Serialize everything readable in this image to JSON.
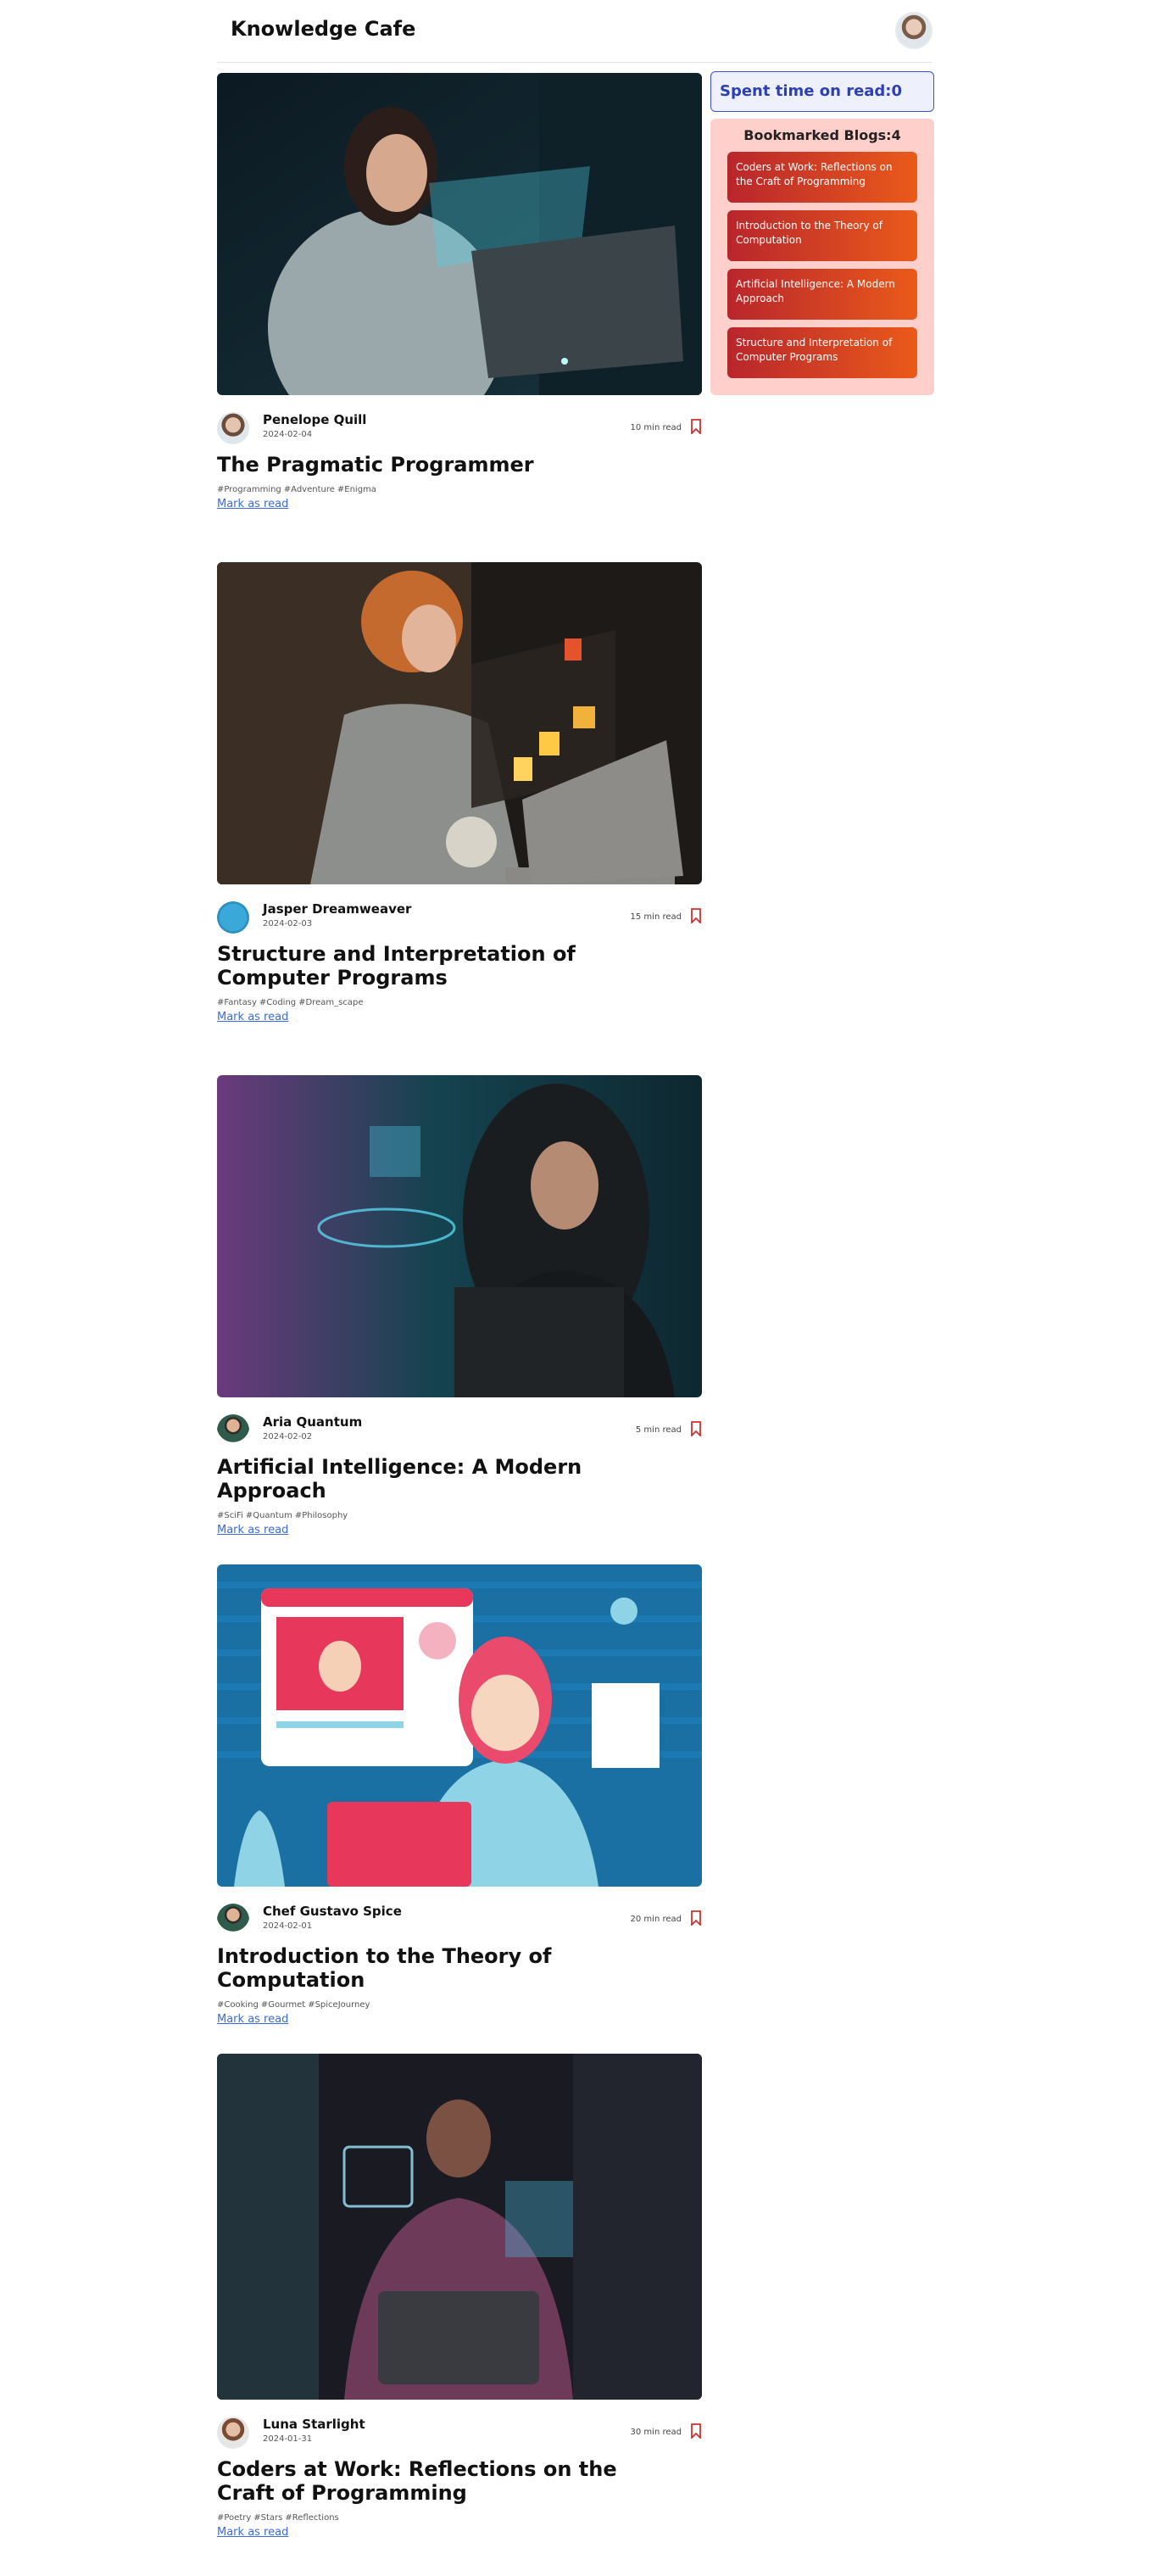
{
  "header": {
    "brand": "Knowledge Cafe"
  },
  "sidebar": {
    "spent_label": "Spent time on read:0",
    "bookmarks_heading": "Bookmarked Blogs:4",
    "bookmarks": [
      "Coders at Work: Reflections on the Craft of Programming",
      "Introduction to the Theory of Computation",
      "Artificial Intelligence: A Modern Approach",
      "Structure and Interpretation of Computer Programs"
    ]
  },
  "blogs": [
    {
      "author": "Penelope Quill",
      "date": "2024-02-04",
      "read_time": "10 min read",
      "title": "The Pragmatic Programmer",
      "tags": [
        "#Programming",
        "#Adventure",
        "#Enigma"
      ],
      "mark_read": "Mark as read"
    },
    {
      "author": "Jasper Dreamweaver",
      "date": "2024-02-03",
      "read_time": "15 min read",
      "title": "Structure and Interpretation of Computer Programs",
      "tags": [
        "#Fantasy",
        "#Coding",
        "#Dream_scape"
      ],
      "mark_read": "Mark as read"
    },
    {
      "author": "Aria Quantum",
      "date": "2024-02-02",
      "read_time": "5 min read",
      "title": "Artificial Intelligence: A Modern Approach",
      "tags": [
        "#SciFi",
        "#Quantum",
        "#Philosophy"
      ],
      "mark_read": "Mark as read"
    },
    {
      "author": "Chef Gustavo Spice",
      "date": "2024-02-01",
      "read_time": "20 min read",
      "title": "Introduction to the Theory of Computation",
      "tags": [
        "#Cooking",
        "#Gourmet",
        "#SpiceJourney"
      ],
      "mark_read": "Mark as read"
    },
    {
      "author": "Luna Starlight",
      "date": "2024-01-31",
      "read_time": "30 min read",
      "title": "Coders at Work: Reflections on the Craft of Programming",
      "tags": [
        "#Poetry",
        "#Stars",
        "#Reflections"
      ],
      "mark_read": "Mark as read"
    }
  ]
}
